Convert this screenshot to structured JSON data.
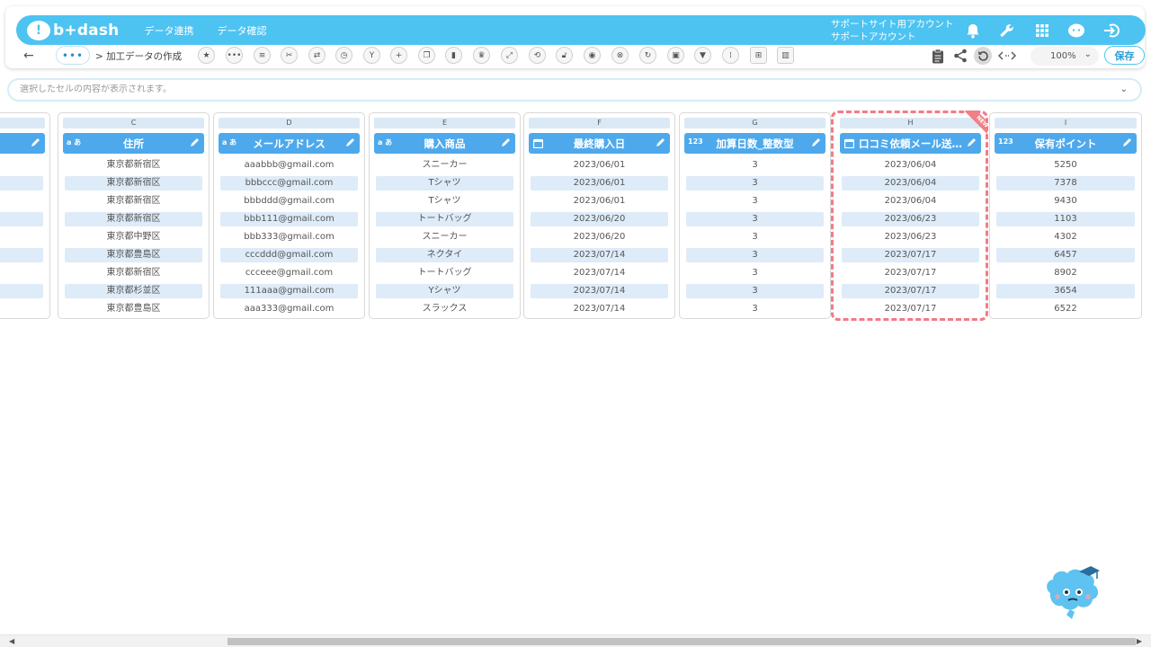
{
  "app": {
    "logo_text": "b+dash"
  },
  "nav": {
    "link1": "データ連携",
    "link2": "データ確認"
  },
  "account": {
    "line1": "サポートサイト用アカウント",
    "line2": "サポートアカウント"
  },
  "toolbar": {
    "more": "•••",
    "breadcrumb": "> 加工データの作成",
    "zoom": "100%",
    "save": "保存"
  },
  "cell_bar": {
    "placeholder": "選択したセルの内容が表示されます。"
  },
  "columns": {
    "b": {
      "letter": "",
      "title": ""
    },
    "c": {
      "letter": "C",
      "type": "a あ",
      "title": "住所",
      "rows": [
        "東京都新宿区",
        "東京都新宿区",
        "東京都新宿区",
        "東京都新宿区",
        "東京都中野区",
        "東京都豊島区",
        "東京都新宿区",
        "東京都杉並区",
        "東京都豊島区"
      ]
    },
    "d": {
      "letter": "D",
      "type": "a あ",
      "title": "メールアドレス",
      "rows": [
        "aaabbb@gmail.com",
        "bbbccc@gmail.com",
        "bbbddd@gmail.com",
        "bbb111@gmail.com",
        "bbb333@gmail.com",
        "cccddd@gmail.com",
        "ccceee@gmail.com",
        "111aaa@gmail.com",
        "aaa333@gmail.com"
      ]
    },
    "e": {
      "letter": "E",
      "type": "a あ",
      "title": "購入商品",
      "rows": [
        "スニーカー",
        "Tシャツ",
        "Tシャツ",
        "トートバッグ",
        "スニーカー",
        "ネクタイ",
        "トートバッグ",
        "Yシャツ",
        "スラックス"
      ]
    },
    "f": {
      "letter": "F",
      "title": "最終購入日",
      "rows": [
        "2023/06/01",
        "2023/06/01",
        "2023/06/01",
        "2023/06/20",
        "2023/06/20",
        "2023/07/14",
        "2023/07/14",
        "2023/07/14",
        "2023/07/14"
      ]
    },
    "g": {
      "letter": "G",
      "type": "123",
      "title": "加算日数_整数型",
      "rows": [
        "3",
        "3",
        "3",
        "3",
        "3",
        "3",
        "3",
        "3",
        "3"
      ]
    },
    "h": {
      "letter": "H",
      "title": "口コミ依頼メール送…",
      "badge": "NEW",
      "rows": [
        "2023/06/04",
        "2023/06/04",
        "2023/06/04",
        "2023/06/23",
        "2023/06/23",
        "2023/07/17",
        "2023/07/17",
        "2023/07/17",
        "2023/07/17"
      ]
    },
    "i": {
      "letter": "I",
      "type": "123",
      "title": "保有ポイント",
      "rows": [
        "5250",
        "7378",
        "9430",
        "1103",
        "4302",
        "6457",
        "8902",
        "3654",
        "6522"
      ]
    }
  },
  "colors": {
    "brand": "#4dc3f2",
    "header": "#4ea9ec",
    "alt_row": "#deebf8",
    "new_highlight": "#f27b86"
  }
}
